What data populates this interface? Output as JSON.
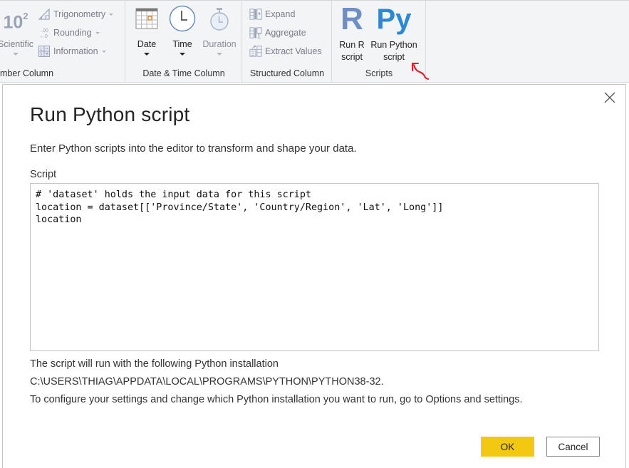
{
  "ribbon": {
    "number_column": {
      "label": "mber Column",
      "scientific": {
        "big": "10",
        "sup": "2",
        "label": "Scientific"
      },
      "trigonometry": "Trigonometry",
      "rounding": "Rounding",
      "information": "Information"
    },
    "date_time_column": {
      "label": "Date & Time Column",
      "date": "Date",
      "time": "Time",
      "duration": "Duration"
    },
    "structured_column": {
      "label": "Structured Column",
      "expand": "Expand",
      "aggregate": "Aggregate",
      "extract_values": "Extract Values"
    },
    "scripts": {
      "label": "Scripts",
      "run_r": {
        "glyph": "R",
        "line1": "Run R",
        "line2": "script"
      },
      "run_python": {
        "glyph": "Py",
        "line1": "Run Python",
        "line2": "script"
      }
    }
  },
  "dialog": {
    "title": "Run Python script",
    "subtitle": "Enter Python scripts into the editor to transform and shape your data.",
    "script_label": "Script",
    "script_lines": [
      "# 'dataset' holds the input data for this script",
      "location = dataset[['Province/State', 'Country/Region', 'Lat', 'Long']]",
      "location"
    ],
    "info_line1": "The script will run with the following Python installation",
    "install_path": "C:\\USERS\\THIAG\\APPDATA\\LOCAL\\PROGRAMS\\PYTHON\\PYTHON38-32.",
    "info_line3": "To configure your settings and change which Python installation you want to run, go to Options and settings.",
    "ok_label": "OK",
    "cancel_label": "Cancel"
  },
  "colors": {
    "ok_button": "#f2c811",
    "r_icon": "#6f8fc4",
    "python_icon": "#2b88d8",
    "annotation": "#e81123"
  }
}
